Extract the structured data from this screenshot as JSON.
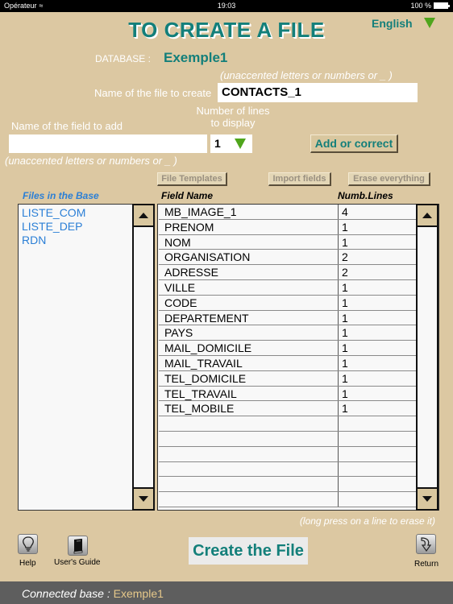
{
  "status_bar": {
    "carrier": "Opérateur",
    "time": "19:03",
    "battery": "100 %"
  },
  "header": {
    "title": "TO CREATE A FILE",
    "language": "English"
  },
  "database": {
    "label": "DATABASE :",
    "name": "Exemple1"
  },
  "file_form": {
    "hint": "(unaccented letters or numbers or _ )",
    "label": "Name of the file to create",
    "value": "CONTACTS_1"
  },
  "field_form": {
    "label": "Name of the field to add",
    "value": "",
    "hint": "(unaccented letters or numbers or _ )",
    "lines_label_1": "Number of lines",
    "lines_label_2": "to display",
    "lines_value": "1",
    "add_button": "Add or correct"
  },
  "actions": {
    "file_templates": "File Templates",
    "import_fields": "Import fields",
    "erase_everything": "Erase everything"
  },
  "files_panel": {
    "header": "Files in the Base",
    "files": [
      "LISTE_COM",
      "LISTE_DEP",
      "RDN"
    ]
  },
  "fields_table": {
    "headers": {
      "name": "Field Name",
      "lines": "Numb.Lines"
    },
    "rows": [
      {
        "name": "MB_IMAGE_1",
        "lines": "4"
      },
      {
        "name": "PRENOM",
        "lines": "1"
      },
      {
        "name": "NOM",
        "lines": "1"
      },
      {
        "name": "ORGANISATION",
        "lines": "2"
      },
      {
        "name": "ADRESSE",
        "lines": "2"
      },
      {
        "name": "VILLE",
        "lines": "1"
      },
      {
        "name": "CODE",
        "lines": "1"
      },
      {
        "name": "DEPARTEMENT",
        "lines": "1"
      },
      {
        "name": "PAYS",
        "lines": "1"
      },
      {
        "name": "MAIL_DOMICILE",
        "lines": "1"
      },
      {
        "name": "MAIL_TRAVAIL",
        "lines": "1"
      },
      {
        "name": "TEL_DOMICILE",
        "lines": "1"
      },
      {
        "name": "TEL_TRAVAIL",
        "lines": "1"
      },
      {
        "name": "TEL_MOBILE",
        "lines": "1"
      },
      {
        "name": "",
        "lines": ""
      },
      {
        "name": "",
        "lines": ""
      },
      {
        "name": "",
        "lines": ""
      },
      {
        "name": "",
        "lines": ""
      },
      {
        "name": "",
        "lines": ""
      },
      {
        "name": "",
        "lines": ""
      }
    ],
    "footer_hint": "(long press on a line to erase it)"
  },
  "toolbar": {
    "help": "Help",
    "guide": "User's Guide",
    "create": "Create the File",
    "return": "Return"
  },
  "footer": {
    "label": "Connected base :",
    "value": "Exemple1"
  },
  "colors": {
    "background": "#dcc8a2",
    "accent": "#137f7a",
    "file_link": "#2b7fd6",
    "dropdown_arrow": "#4fa51c",
    "footer_bg": "#5e5e5e"
  }
}
